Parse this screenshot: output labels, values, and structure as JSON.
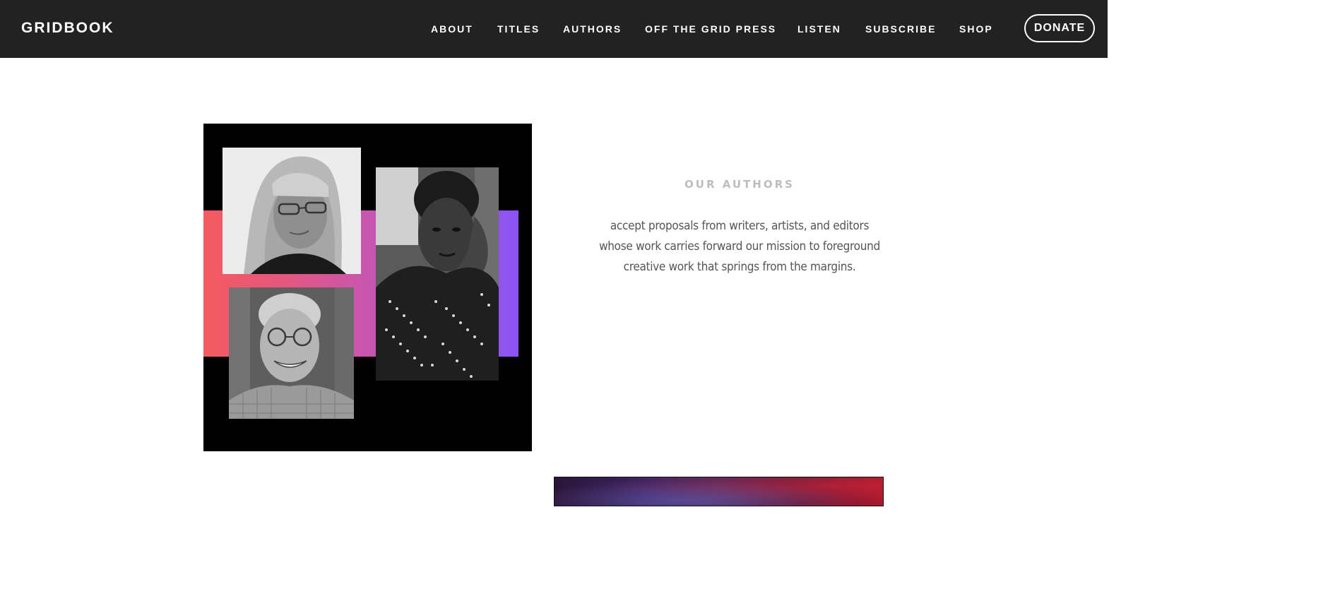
{
  "header": {
    "brand": "GRIDBOOK",
    "nav": [
      "ABOUT",
      "TITLES",
      "AUTHORS",
      "OFF THE GRID PRESS",
      "LISTEN",
      "SUBSCRIBE",
      "SHOP"
    ],
    "donate": "DONATE"
  },
  "section": {
    "eyebrow": "OUR  AUTHORS",
    "blurb": "accept proposals from writers, artists, and editors whose work carries forward our mission to foreground creative work that springs from the margins."
  },
  "colors": {
    "topbar": "#222222",
    "gradient_start": "#f45a5f",
    "gradient_end": "#8b53f5",
    "eyebrow": "#bdbdbd",
    "body_text": "#555555"
  }
}
